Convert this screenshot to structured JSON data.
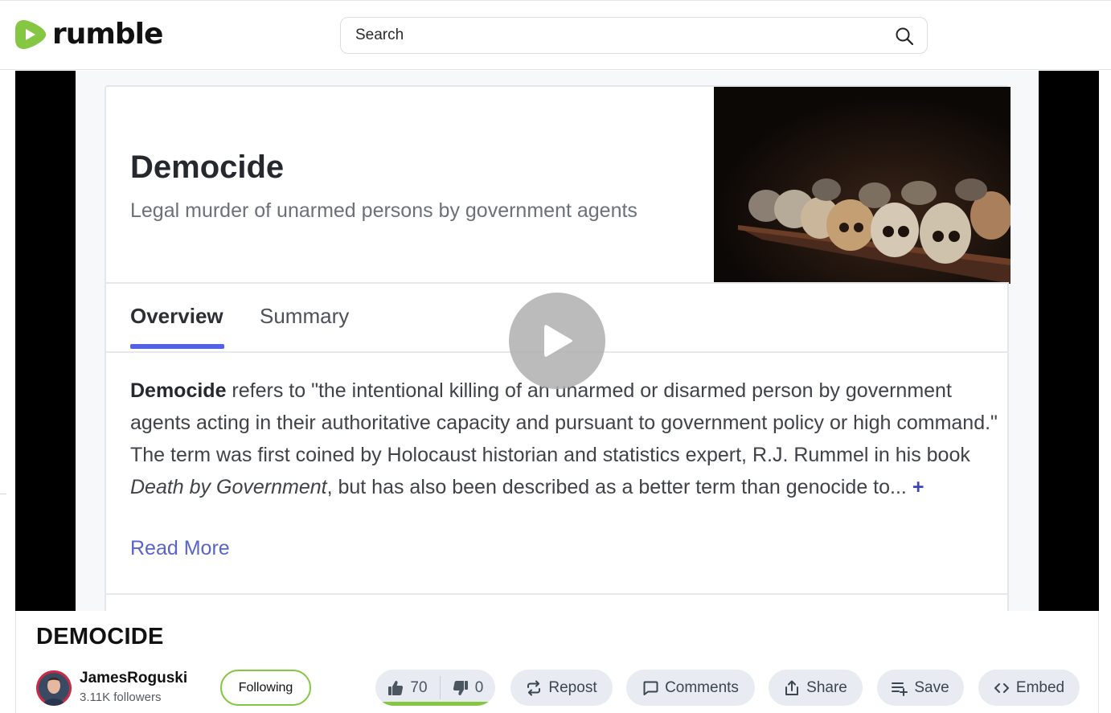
{
  "header": {
    "logo_text": "rumble",
    "search": {
      "placeholder": "Search",
      "value": ""
    }
  },
  "video_frame": {
    "title": "Democide",
    "subtitle": "Legal murder of unarmed persons by government agents",
    "tabs": [
      {
        "label": "Overview",
        "active": true
      },
      {
        "label": "Summary",
        "active": false
      }
    ],
    "body": {
      "bold_term": "Democide",
      "text_1": " refers to \"the intentional killing of an unarmed or disarmed person by government agents acting in their authoritative capacity and pursuant to government policy or high command.\" The term was first coined by Holocaust historian and statistics expert, R.J. Rummel in his book ",
      "book_title": "Death by Government",
      "text_2": ", but has also been described as a better term than genocide to... ",
      "plus": "+"
    },
    "read_more": "Read More"
  },
  "video": {
    "title": "DEMOCIDE",
    "channel": {
      "name": "JamesRoguski",
      "followers": "3.11K followers"
    },
    "follow_label": "Following",
    "votes": {
      "likes": "70",
      "dislikes": "0",
      "like_ratio": 1.0
    },
    "actions": {
      "repost": "Repost",
      "comments": "Comments",
      "share": "Share",
      "save": "Save",
      "embed": "Embed"
    }
  },
  "colors": {
    "brand_green": "#85c742",
    "tab_accent": "#5361e6",
    "pill_bg": "#e8ebf2"
  },
  "icons": [
    "rumble-logo-icon",
    "search-icon",
    "play-icon",
    "thumbs-up-icon",
    "thumbs-down-icon",
    "repost-icon",
    "comments-icon",
    "share-icon",
    "save-icon",
    "embed-icon"
  ]
}
